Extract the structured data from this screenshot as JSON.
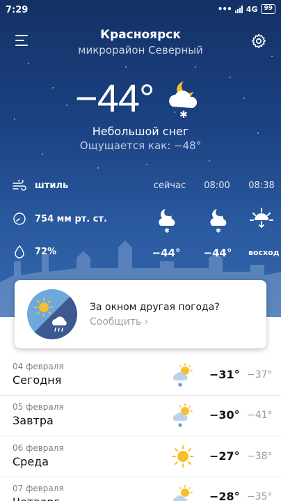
{
  "status_bar": {
    "time": "7:29",
    "network": "4G",
    "battery": "99"
  },
  "header": {
    "city": "Красноярск",
    "district": "микрорайон Северный"
  },
  "current": {
    "temperature": "−44°",
    "condition": "Небольшой снег",
    "feels_like": "Ощущается как: −48°",
    "icon": "moon-cloud-snow-icon"
  },
  "details": {
    "wind": "штиль",
    "pressure": "754 мм рт. ст.",
    "humidity": "72%"
  },
  "hourly": [
    {
      "time": "сейчас",
      "temp": "−44°",
      "icon": "moon-cloud-snow-icon"
    },
    {
      "time": "08:00",
      "temp": "−44°",
      "icon": "moon-cloud-snow-icon"
    },
    {
      "time": "08:38",
      "temp": "восход",
      "icon": "sunrise-icon"
    }
  ],
  "report_card": {
    "question": "За окном другая погода?",
    "action": "Сообщить",
    "chevron": "›"
  },
  "forecast": [
    {
      "date": "04 февраля",
      "day": "Сегодня",
      "hi": "−31°",
      "lo": "−37°",
      "icon": "sun-cloud-snow-icon"
    },
    {
      "date": "05 февраля",
      "day": "Завтра",
      "hi": "−30°",
      "lo": "−41°",
      "icon": "sun-cloud-snow-icon"
    },
    {
      "date": "06 февраля",
      "day": "Среда",
      "hi": "−27°",
      "lo": "−38°",
      "icon": "sun-icon"
    },
    {
      "date": "07 февраля",
      "day": "Четверг",
      "hi": "−28°",
      "lo": "−35°",
      "icon": "sun-cloud-icon"
    }
  ],
  "colors": {
    "sky_top": "#143166",
    "sky_bottom": "#3569ad",
    "sun": "#f6c02c",
    "text_dark": "#111111",
    "text_muted": "#9a9a9a"
  }
}
